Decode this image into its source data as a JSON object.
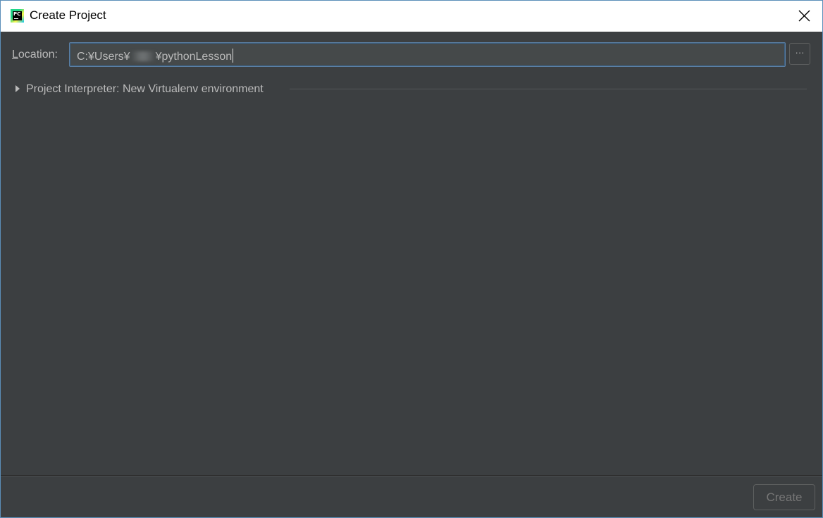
{
  "window": {
    "title": "Create Project",
    "app_icon_text": "PC"
  },
  "location": {
    "label_mnemonic": "L",
    "label_rest": "ocation:",
    "value_prefix": "C:¥Users¥",
    "value_suffix": "¥pythonLesson",
    "browse_label": "···"
  },
  "interpreter": {
    "label": "Project Interpreter: New Virtualenv environment",
    "expanded": false
  },
  "footer": {
    "create_label": "Create",
    "create_enabled": false
  },
  "colors": {
    "background": "#3c3f41",
    "titlebar": "#ffffff",
    "text": "#bbbbbb",
    "focus_border": "#5a7fa4"
  }
}
